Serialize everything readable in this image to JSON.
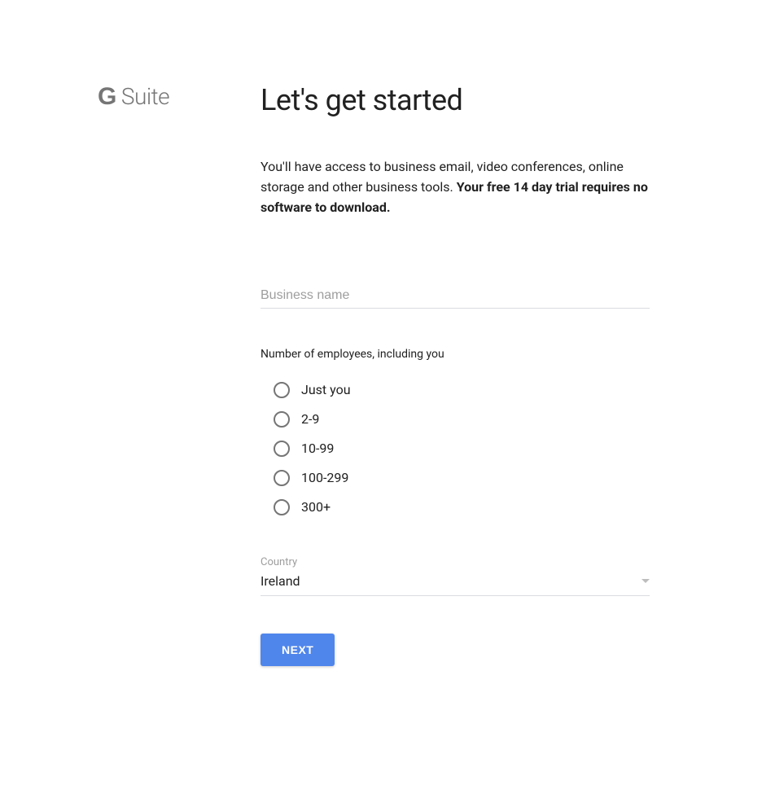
{
  "logo": {
    "g": "G",
    "suite": "Suite"
  },
  "heading": "Let's get started",
  "intro": {
    "lead": "You'll have access to business email, video conferences, online storage and other business tools. ",
    "bold": "Your free 14 day trial requires no software to download."
  },
  "business_name": {
    "placeholder": "Business name",
    "value": ""
  },
  "employees": {
    "label": "Number of employees, including you",
    "options": [
      {
        "label": "Just you"
      },
      {
        "label": "2-9"
      },
      {
        "label": "10-99"
      },
      {
        "label": "100-299"
      },
      {
        "label": "300+"
      }
    ]
  },
  "country": {
    "label": "Country",
    "value": "Ireland"
  },
  "next_button": "NEXT"
}
